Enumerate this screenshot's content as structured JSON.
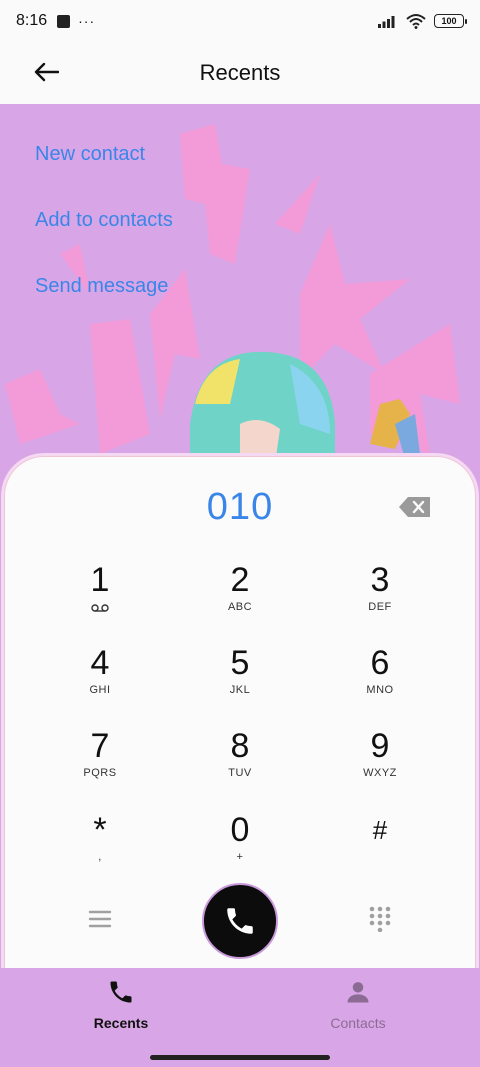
{
  "status_bar": {
    "time": "8:16",
    "overflow": "···",
    "battery": "100"
  },
  "header": {
    "title": "Recents"
  },
  "actions": {
    "new_contact": "New contact",
    "add_to_contacts": "Add to contacts",
    "send_message": "Send message"
  },
  "dialer": {
    "number": "010",
    "keys": [
      {
        "digit": "1",
        "letters": ""
      },
      {
        "digit": "2",
        "letters": "ABC"
      },
      {
        "digit": "3",
        "letters": "DEF"
      },
      {
        "digit": "4",
        "letters": "GHI"
      },
      {
        "digit": "5",
        "letters": "JKL"
      },
      {
        "digit": "6",
        "letters": "MNO"
      },
      {
        "digit": "7",
        "letters": "PQRS"
      },
      {
        "digit": "8",
        "letters": "TUV"
      },
      {
        "digit": "9",
        "letters": "WXYZ"
      },
      {
        "digit": "*",
        "letters": ","
      },
      {
        "digit": "0",
        "letters": "+"
      },
      {
        "digit": "#",
        "letters": ""
      }
    ]
  },
  "nav": {
    "recents": "Recents",
    "contacts": "Contacts"
  },
  "colors": {
    "accent": "#3a86e8",
    "wallpaper": "#d8a6e6",
    "call_button": "#0c0c0c"
  },
  "icons": [
    "back-arrow-icon",
    "voicemail-icon",
    "backspace-icon",
    "menu-icon",
    "phone-icon",
    "keypad-icon",
    "person-icon"
  ]
}
